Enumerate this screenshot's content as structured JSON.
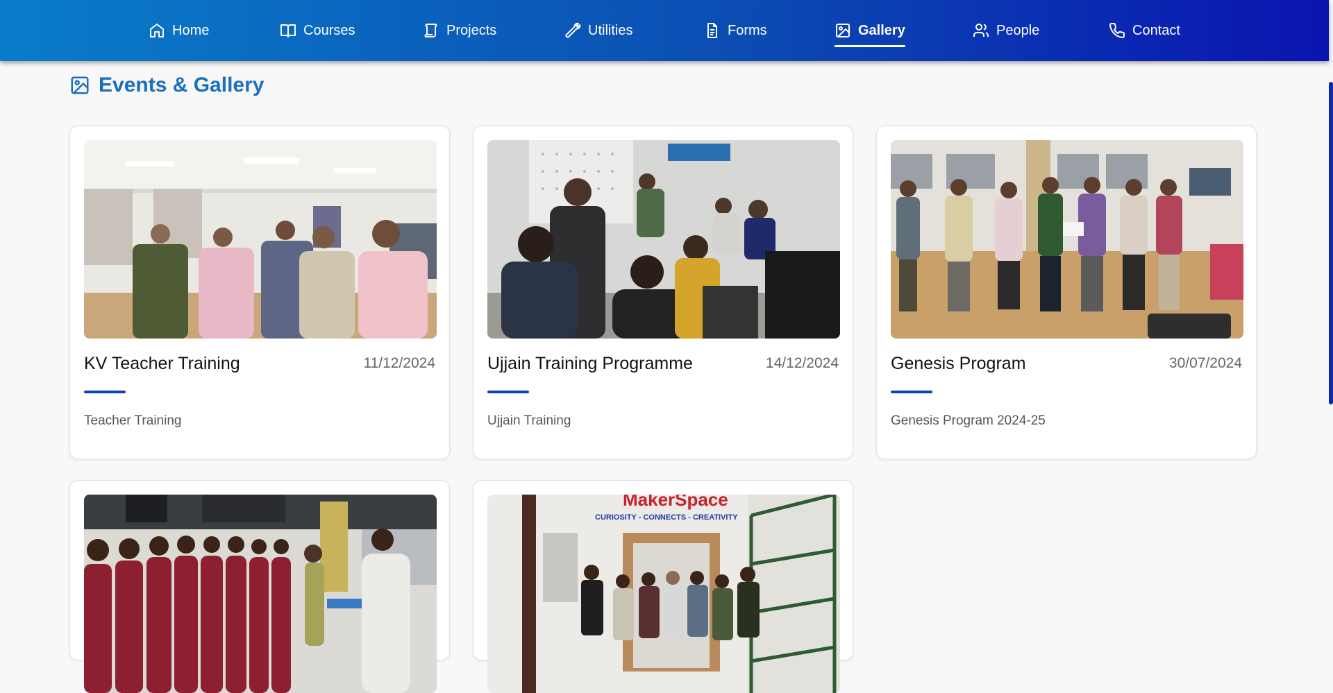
{
  "nav": {
    "items": [
      {
        "label": "Home",
        "icon": "home-icon"
      },
      {
        "label": "Courses",
        "icon": "book-icon"
      },
      {
        "label": "Projects",
        "icon": "scroll-icon"
      },
      {
        "label": "Utilities",
        "icon": "wrench-icon"
      },
      {
        "label": "Forms",
        "icon": "document-icon"
      },
      {
        "label": "Gallery",
        "icon": "image-icon",
        "active": true
      },
      {
        "label": "People",
        "icon": "users-icon"
      },
      {
        "label": "Contact",
        "icon": "phone-icon"
      }
    ]
  },
  "section": {
    "title": "Events & Gallery",
    "icon": "image-icon"
  },
  "cards": [
    {
      "title": "KV Teacher Training",
      "date": "11/12/2024",
      "description": "Teacher Training"
    },
    {
      "title": "Ujjain Training Programme",
      "date": "14/12/2024",
      "description": "Ujjain Training"
    },
    {
      "title": "Genesis Program",
      "date": "30/07/2024",
      "description": "Genesis Program 2024-25"
    },
    {
      "title": "",
      "date": "",
      "description": ""
    },
    {
      "title": "",
      "date": "",
      "description": "",
      "sign": {
        "main": "MakerSpace",
        "tagline": "CURIOSITY - CONNECTS - CREATIVITY"
      }
    }
  ],
  "colors": {
    "nav_start": "#0a7dc9",
    "nav_end": "#0a14b0",
    "accent": "#1a6fc0",
    "bar": "#0a44b8"
  }
}
